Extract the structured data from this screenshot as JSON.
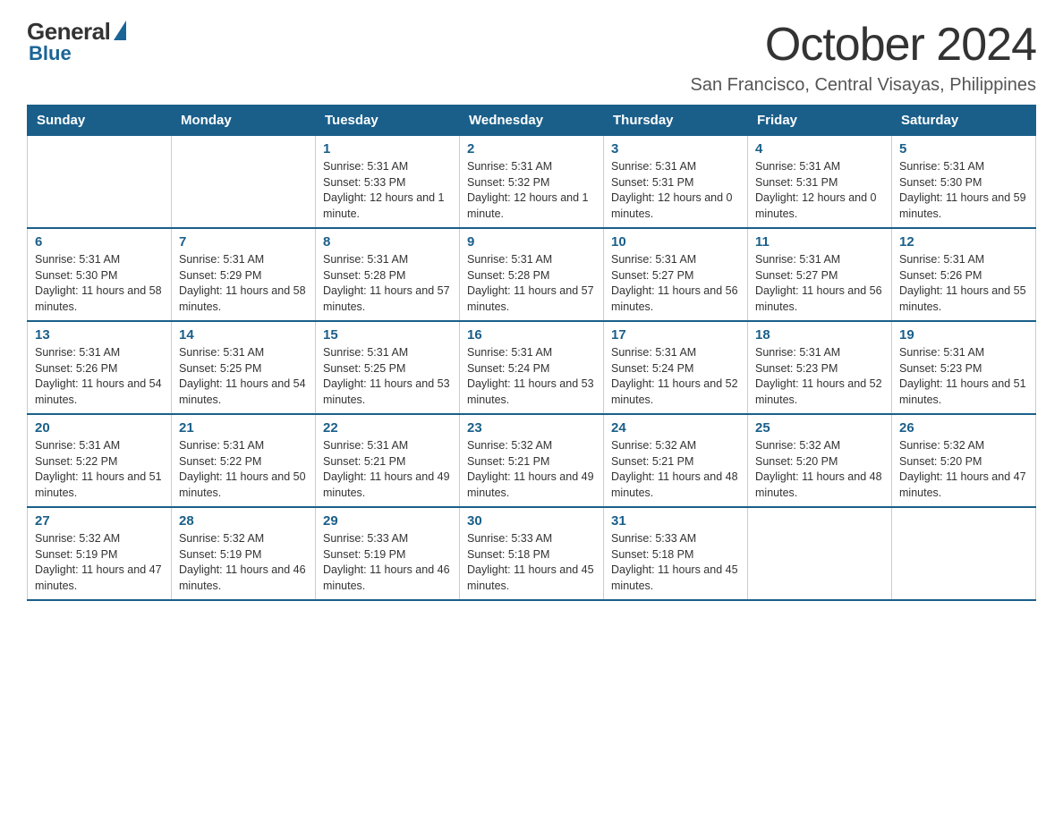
{
  "logo": {
    "general": "General",
    "blue": "Blue"
  },
  "title": {
    "month": "October 2024",
    "location": "San Francisco, Central Visayas, Philippines"
  },
  "calendar": {
    "headers": [
      "Sunday",
      "Monday",
      "Tuesday",
      "Wednesday",
      "Thursday",
      "Friday",
      "Saturday"
    ],
    "weeks": [
      [
        {
          "day": "",
          "info": ""
        },
        {
          "day": "",
          "info": ""
        },
        {
          "day": "1",
          "info": "Sunrise: 5:31 AM\nSunset: 5:33 PM\nDaylight: 12 hours and 1 minute."
        },
        {
          "day": "2",
          "info": "Sunrise: 5:31 AM\nSunset: 5:32 PM\nDaylight: 12 hours and 1 minute."
        },
        {
          "day": "3",
          "info": "Sunrise: 5:31 AM\nSunset: 5:31 PM\nDaylight: 12 hours and 0 minutes."
        },
        {
          "day": "4",
          "info": "Sunrise: 5:31 AM\nSunset: 5:31 PM\nDaylight: 12 hours and 0 minutes."
        },
        {
          "day": "5",
          "info": "Sunrise: 5:31 AM\nSunset: 5:30 PM\nDaylight: 11 hours and 59 minutes."
        }
      ],
      [
        {
          "day": "6",
          "info": "Sunrise: 5:31 AM\nSunset: 5:30 PM\nDaylight: 11 hours and 58 minutes."
        },
        {
          "day": "7",
          "info": "Sunrise: 5:31 AM\nSunset: 5:29 PM\nDaylight: 11 hours and 58 minutes."
        },
        {
          "day": "8",
          "info": "Sunrise: 5:31 AM\nSunset: 5:28 PM\nDaylight: 11 hours and 57 minutes."
        },
        {
          "day": "9",
          "info": "Sunrise: 5:31 AM\nSunset: 5:28 PM\nDaylight: 11 hours and 57 minutes."
        },
        {
          "day": "10",
          "info": "Sunrise: 5:31 AM\nSunset: 5:27 PM\nDaylight: 11 hours and 56 minutes."
        },
        {
          "day": "11",
          "info": "Sunrise: 5:31 AM\nSunset: 5:27 PM\nDaylight: 11 hours and 56 minutes."
        },
        {
          "day": "12",
          "info": "Sunrise: 5:31 AM\nSunset: 5:26 PM\nDaylight: 11 hours and 55 minutes."
        }
      ],
      [
        {
          "day": "13",
          "info": "Sunrise: 5:31 AM\nSunset: 5:26 PM\nDaylight: 11 hours and 54 minutes."
        },
        {
          "day": "14",
          "info": "Sunrise: 5:31 AM\nSunset: 5:25 PM\nDaylight: 11 hours and 54 minutes."
        },
        {
          "day": "15",
          "info": "Sunrise: 5:31 AM\nSunset: 5:25 PM\nDaylight: 11 hours and 53 minutes."
        },
        {
          "day": "16",
          "info": "Sunrise: 5:31 AM\nSunset: 5:24 PM\nDaylight: 11 hours and 53 minutes."
        },
        {
          "day": "17",
          "info": "Sunrise: 5:31 AM\nSunset: 5:24 PM\nDaylight: 11 hours and 52 minutes."
        },
        {
          "day": "18",
          "info": "Sunrise: 5:31 AM\nSunset: 5:23 PM\nDaylight: 11 hours and 52 minutes."
        },
        {
          "day": "19",
          "info": "Sunrise: 5:31 AM\nSunset: 5:23 PM\nDaylight: 11 hours and 51 minutes."
        }
      ],
      [
        {
          "day": "20",
          "info": "Sunrise: 5:31 AM\nSunset: 5:22 PM\nDaylight: 11 hours and 51 minutes."
        },
        {
          "day": "21",
          "info": "Sunrise: 5:31 AM\nSunset: 5:22 PM\nDaylight: 11 hours and 50 minutes."
        },
        {
          "day": "22",
          "info": "Sunrise: 5:31 AM\nSunset: 5:21 PM\nDaylight: 11 hours and 49 minutes."
        },
        {
          "day": "23",
          "info": "Sunrise: 5:32 AM\nSunset: 5:21 PM\nDaylight: 11 hours and 49 minutes."
        },
        {
          "day": "24",
          "info": "Sunrise: 5:32 AM\nSunset: 5:21 PM\nDaylight: 11 hours and 48 minutes."
        },
        {
          "day": "25",
          "info": "Sunrise: 5:32 AM\nSunset: 5:20 PM\nDaylight: 11 hours and 48 minutes."
        },
        {
          "day": "26",
          "info": "Sunrise: 5:32 AM\nSunset: 5:20 PM\nDaylight: 11 hours and 47 minutes."
        }
      ],
      [
        {
          "day": "27",
          "info": "Sunrise: 5:32 AM\nSunset: 5:19 PM\nDaylight: 11 hours and 47 minutes."
        },
        {
          "day": "28",
          "info": "Sunrise: 5:32 AM\nSunset: 5:19 PM\nDaylight: 11 hours and 46 minutes."
        },
        {
          "day": "29",
          "info": "Sunrise: 5:33 AM\nSunset: 5:19 PM\nDaylight: 11 hours and 46 minutes."
        },
        {
          "day": "30",
          "info": "Sunrise: 5:33 AM\nSunset: 5:18 PM\nDaylight: 11 hours and 45 minutes."
        },
        {
          "day": "31",
          "info": "Sunrise: 5:33 AM\nSunset: 5:18 PM\nDaylight: 11 hours and 45 minutes."
        },
        {
          "day": "",
          "info": ""
        },
        {
          "day": "",
          "info": ""
        }
      ]
    ]
  }
}
